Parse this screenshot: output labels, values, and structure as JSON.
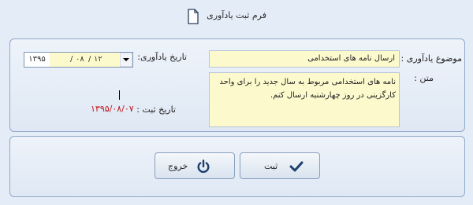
{
  "form": {
    "title": "فرم ثبت یادآوری",
    "icon": "document-icon"
  },
  "fields": {
    "subject_label": "موضوع یادآوری :",
    "subject_value": "ارسال نامه های استخدامی",
    "text_label": "متن :",
    "text_value": "نامه های استخدامی مربوط به سال جدید را برای واحد کارگزینی در روز چهارشنبه ارسال کنم.",
    "reminder_date_label": "تاریخ یادآوری:",
    "reminder_date": {
      "year": "۱۳۹۵",
      "month": "۰۸",
      "day": "۱۲",
      "separator": "/"
    },
    "registration_date_label": "تاریخ ثبت :",
    "registration_date_value": "۱۳۹۵/۰۸/۰۷"
  },
  "buttons": {
    "save_label": "ثبت",
    "save_icon": "checkmark-icon",
    "exit_label": "خروج",
    "exit_icon": "power-icon"
  },
  "colors": {
    "background": "#e4ecf7",
    "input_fill": "#fcfacd",
    "registration_date": "#c0141c",
    "icon_dark": "#1f3f6e"
  }
}
